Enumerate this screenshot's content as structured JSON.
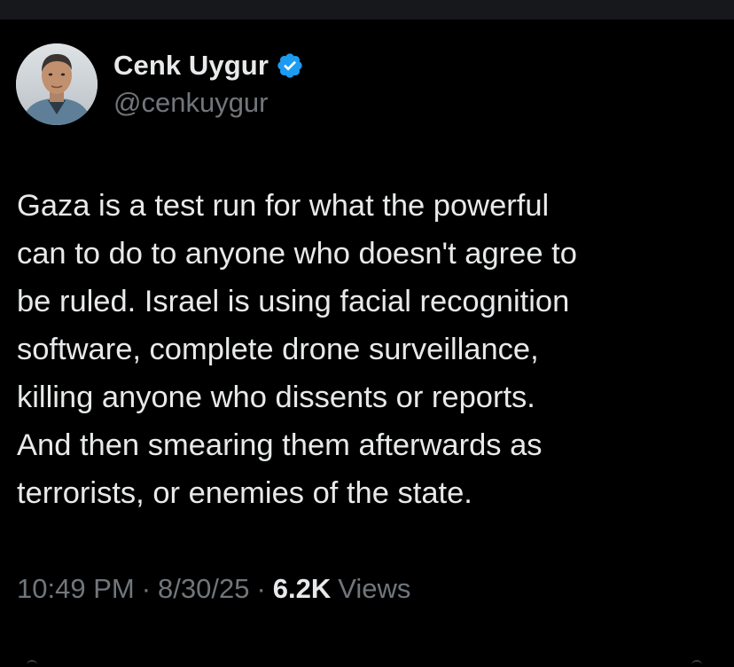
{
  "tweet": {
    "author": {
      "display_name": "Cenk Uygur",
      "handle": "@cenkuygur",
      "verified": true,
      "verified_icon": "verified-badge-icon",
      "verified_color": "#1d9bf0"
    },
    "text": "Gaza is a test run for what the powerful\ncan to do to anyone who doesn't agree to\nbe ruled. Israel is using facial recognition\nsoftware, complete drone surveillance,\nkilling anyone who dissents or reports.\nAnd then smearing them afterwards as\nterrorists, or enemies of the state.",
    "time": "10:49 PM",
    "separator": "·",
    "date": "8/30/25",
    "views_count": "6.2K",
    "views_label": "Views"
  },
  "theme": {
    "background": "#000000",
    "text_primary": "#e7e9ea",
    "text_secondary": "#71767b"
  }
}
